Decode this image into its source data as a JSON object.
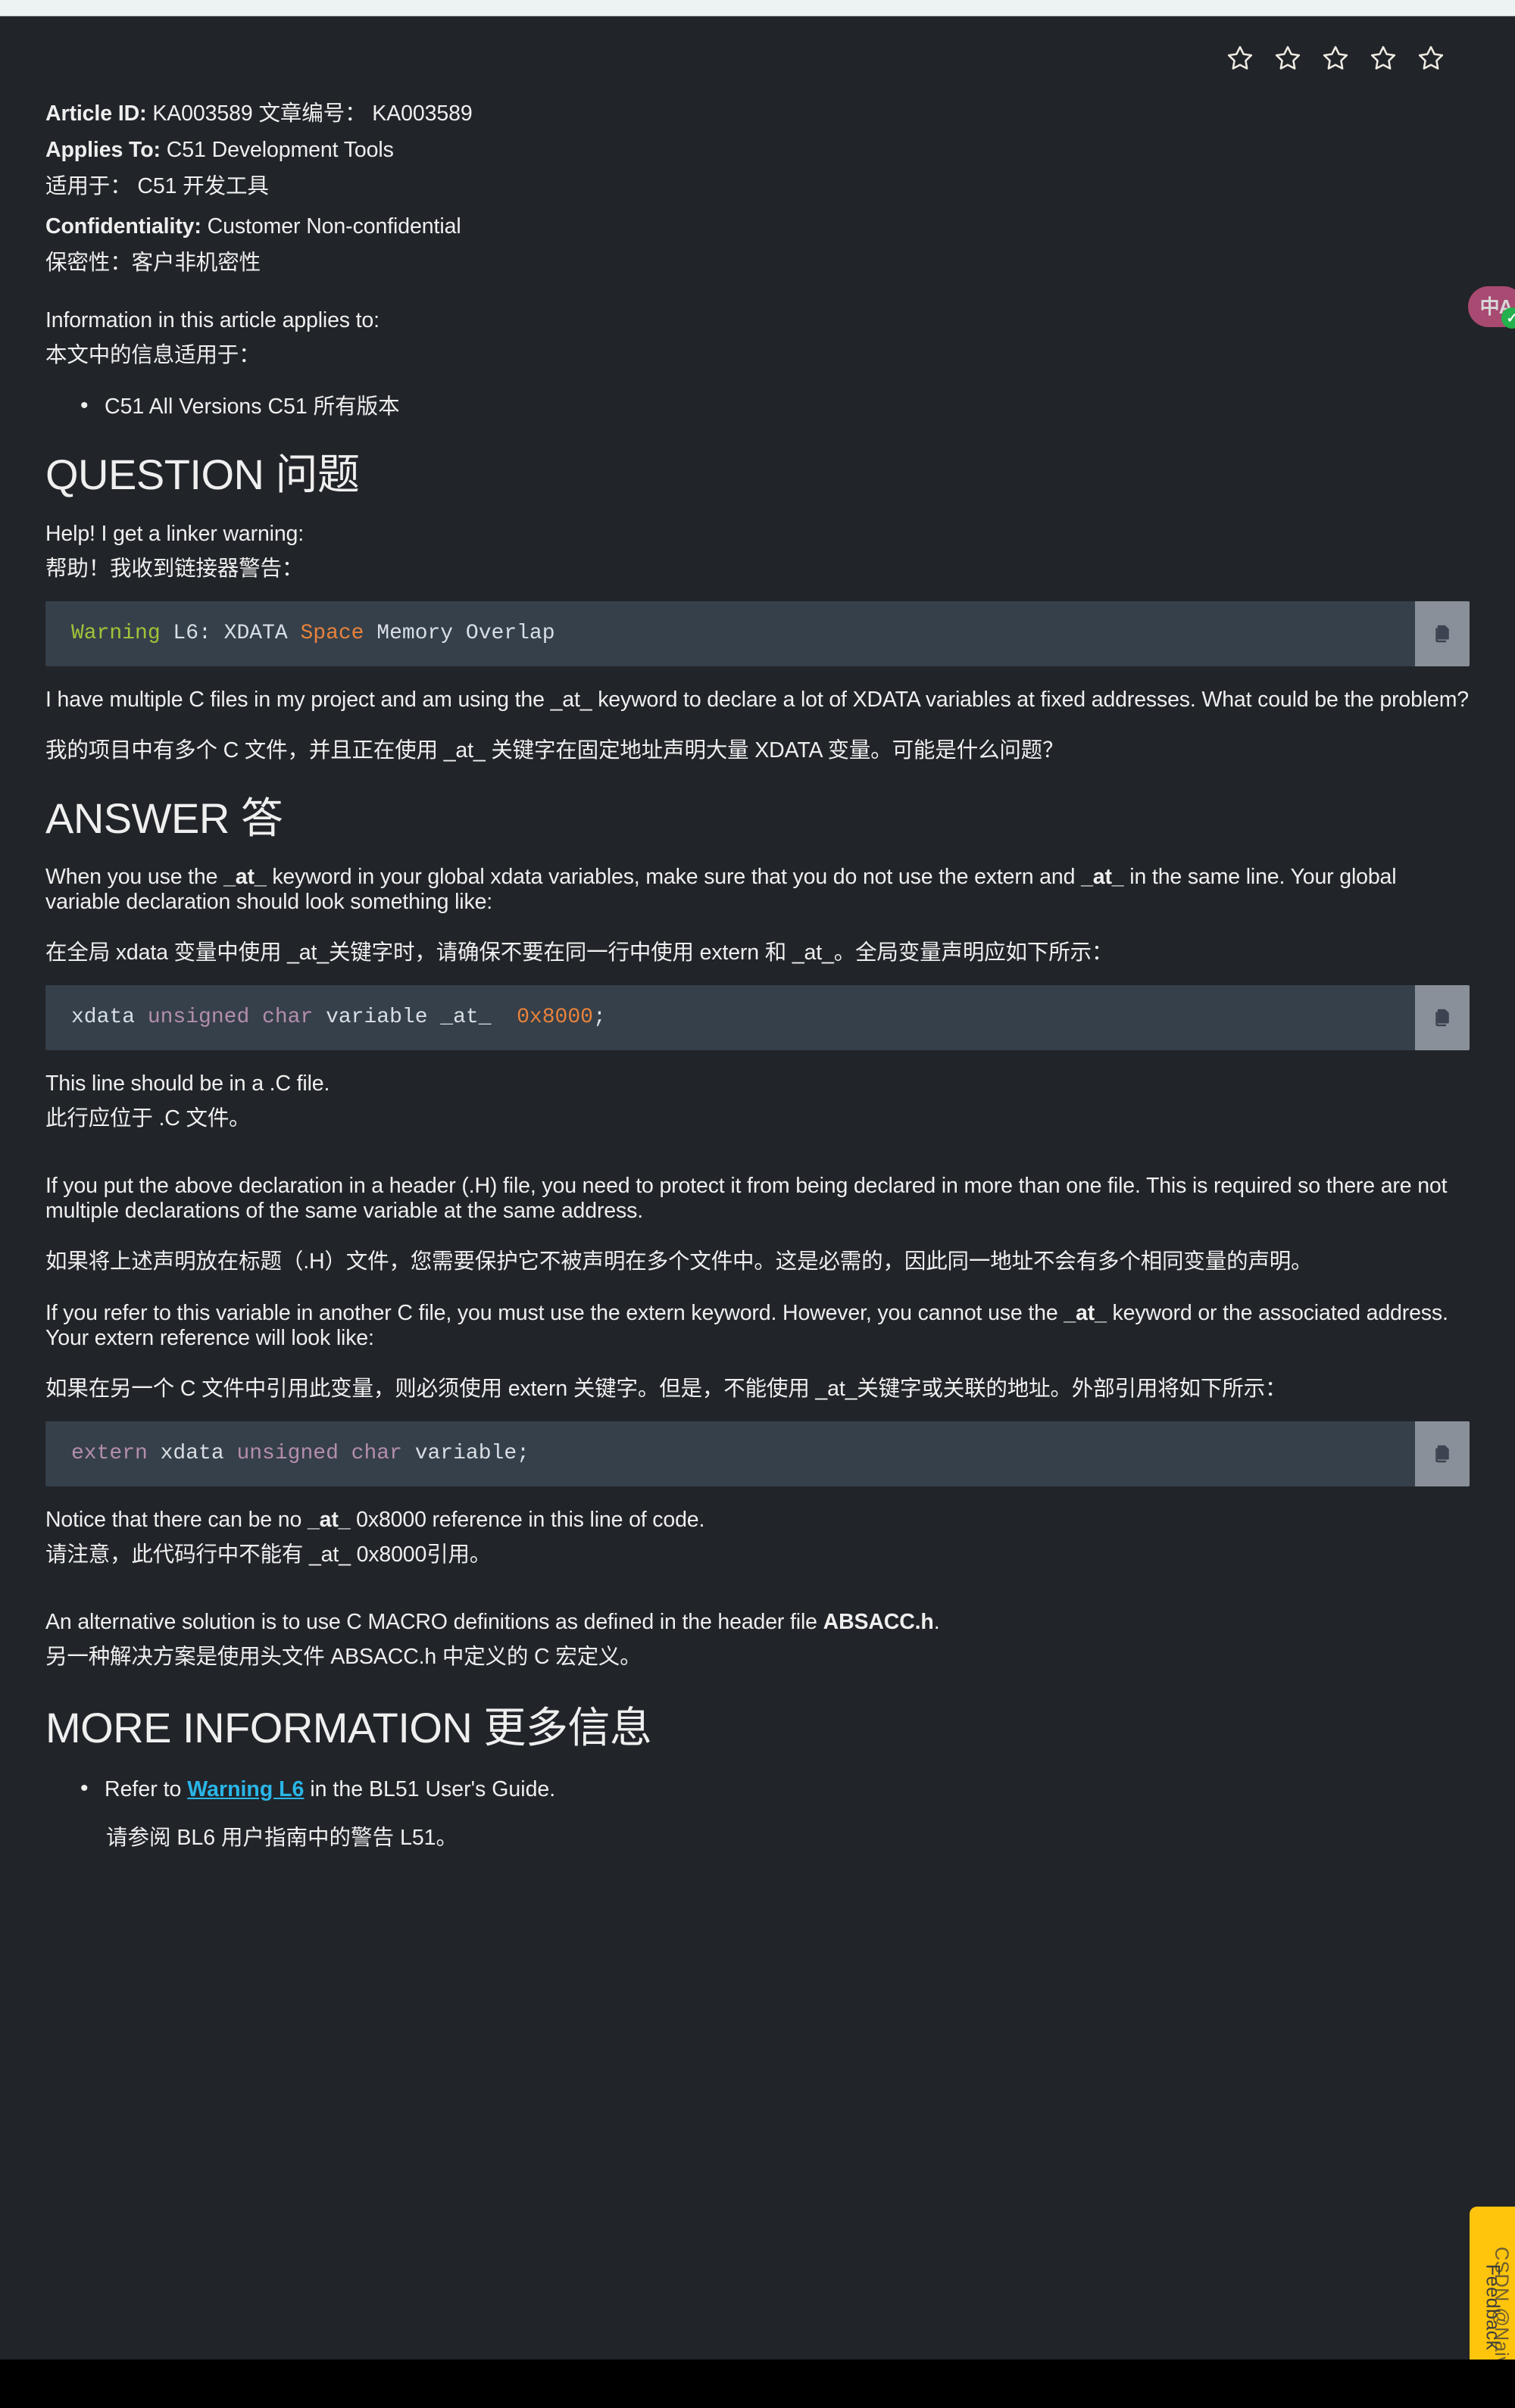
{
  "page": {
    "background": "#212429",
    "code_bg": "#36404a",
    "accent_link": "#29b6e8",
    "feedback_bg": "#ffc40c"
  },
  "rating": {
    "name": "article-star-rating",
    "stars": 5,
    "filled": 0
  },
  "meta": {
    "article_id_label": "Article ID:",
    "article_id_value": "KA003589 文章编号： KA003589",
    "applies_to_label": "Applies To:",
    "applies_to_value": "C51 Development Tools",
    "applies_to_cn": "适用于： C51 开发工具",
    "confidentiality_label": "Confidentiality:",
    "confidentiality_value": "Customer Non-confidential",
    "confidentiality_cn": "保密性：客户非机密性"
  },
  "intro": {
    "en": "Information in this article applies to:",
    "cn": "本文中的信息适用于：",
    "bullets": [
      {
        "en": "C51 All Versions C51 所有版本"
      }
    ]
  },
  "question": {
    "heading": "QUESTION 问题",
    "lead_en": "Help! I get a linker warning:",
    "lead_cn": "帮助！我收到链接器警告：",
    "code": {
      "raw": "Warning L6: XDATA Space Memory Overlap",
      "tokens": [
        {
          "text": "Warning",
          "color": "green"
        },
        {
          "text": " L6: XDATA ",
          "color": "plain"
        },
        {
          "text": "Space",
          "color": "orange"
        },
        {
          "text": " Memory Overlap",
          "color": "plain"
        }
      ],
      "copy_label": "copy-icon"
    },
    "body_en": "I have multiple C files in my project and am using the _at_ keyword to declare a lot of XDATA variables at fixed addresses. What could be the problem?",
    "body_cn": "我的项目中有多个 C 文件，并且正在使用 _at_ 关键字在固定地址声明大量 XDATA 变量。可能是什么问题？"
  },
  "answer": {
    "heading": "ANSWER 答",
    "p1_en_a": "When you use the ",
    "p1_en_at1": "_at_",
    "p1_en_b": " keyword in your global xdata variables, make sure that you do not use the extern and ",
    "p1_en_at2": "_at_",
    "p1_en_c": " in the same line. Your global variable declaration should look something like:",
    "p1_cn": "在全局 xdata 变量中使用 _at_关键字时，请确保不要在同一行中使用 extern 和 _at_。全局变量声明应如下所示：",
    "code1": {
      "raw": "xdata unsigned char variable _at_ 0x8000;",
      "tokens": [
        {
          "text": "xdata ",
          "color": "white"
        },
        {
          "text": "unsigned char",
          "color": "purple"
        },
        {
          "text": " variable ",
          "color": "white"
        },
        {
          "text": "_at_",
          "color": "white"
        },
        {
          "text": "  ",
          "color": "white"
        },
        {
          "text": "0x8000",
          "color": "orange"
        },
        {
          "text": ";",
          "color": "white"
        }
      ],
      "copy_label": "copy-icon"
    },
    "p2_en": "This line should be in a .C file.",
    "p2_cn": "此行应位于 .C 文件。",
    "p3_en": "If you put the above declaration in a header (.H) file, you need to protect it from being declared in more than one file. This is required so there are not multiple declarations of the same variable at the same address.",
    "p3_cn": "如果将上述声明放在标题（.H）文件，您需要保护它不被声明在多个文件中。这是必需的，因此同一地址不会有多个相同变量的声明。",
    "p4_en_a": "If you refer to this variable in another C file, you must use the extern keyword. However, you cannot use the ",
    "p4_en_at": "_at_",
    "p4_en_b": " keyword or the associated address. Your extern reference will look like:",
    "p4_cn": "如果在另一个 C 文件中引用此变量，则必须使用 extern 关键字。但是，不能使用 _at_关键字或关联的地址。外部引用将如下所示：",
    "code2": {
      "raw": "extern xdata unsigned char variable;",
      "tokens": [
        {
          "text": "extern",
          "color": "purple"
        },
        {
          "text": " xdata ",
          "color": "white"
        },
        {
          "text": "unsigned char",
          "color": "purple"
        },
        {
          "text": " variable;",
          "color": "white"
        }
      ],
      "copy_label": "copy-icon"
    },
    "p5_en_a": "Notice that there can be no ",
    "p5_en_at": "_at_",
    "p5_en_b": " 0x8000 reference in this line of code.",
    "p5_cn": "请注意，此代码行中不能有 _at_ 0x8000引用。",
    "p6_en_a": "An alternative solution is to use C MACRO definitions as defined in the header file ",
    "p6_en_bold": "ABSACC.h",
    "p6_en_b": ".",
    "p6_cn": "另一种解决方案是使用头文件 ABSACC.h 中定义的 C 宏定义。"
  },
  "more_information": {
    "heading": "MORE INFORMATION 更多信息",
    "item_prefix": "Refer to ",
    "item_link": "Warning L6",
    "item_suffix": " in the BL51 User's Guide.",
    "item_cn": "请参阅 BL6 用户指南中的警告 L51。"
  },
  "translate_widget": {
    "name": "translate-widget",
    "glyph": "中A",
    "check": "✓"
  },
  "feedback": {
    "label": "Feedback",
    "watermark": "CSDN @Naiva"
  }
}
